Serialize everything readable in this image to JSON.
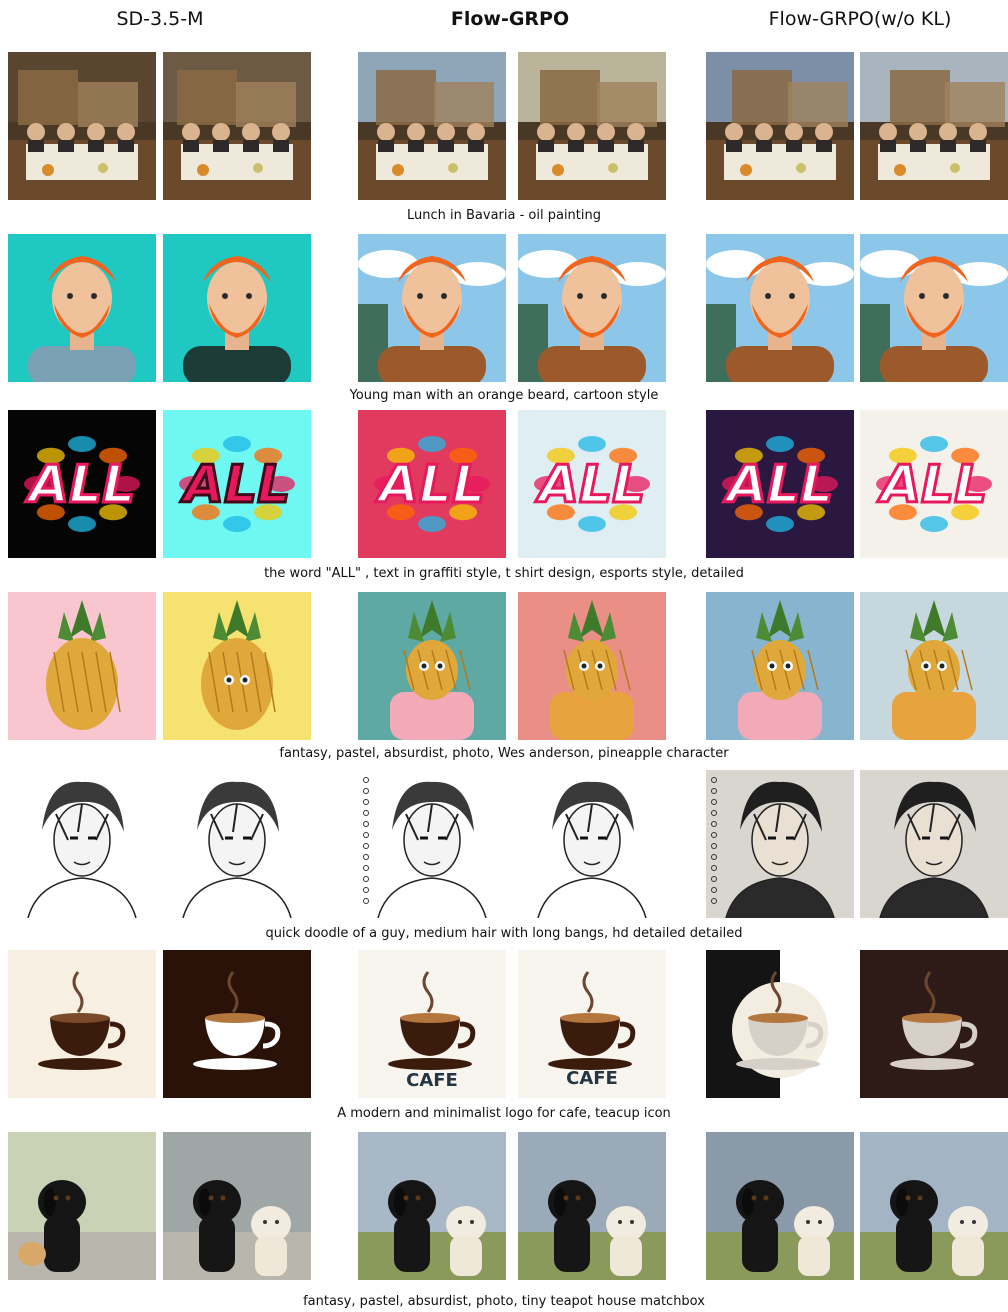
{
  "columns": [
    "SD-3.5-M",
    "Flow-GRPO",
    "Flow-GRPO(w/o KL)"
  ],
  "rows": [
    {
      "caption": "Lunch in Bavaria - oil painting",
      "theme": "painting"
    },
    {
      "caption": "Young man with an orange beard, cartoon style",
      "theme": "beard"
    },
    {
      "caption": "the word \"ALL\" , text in graffiti style, t shirt design, esports style, detailed",
      "theme": "graffiti"
    },
    {
      "caption": "fantasy, pastel, absurdist, photo, Wes anderson, pineapple character",
      "theme": "pineapple"
    },
    {
      "caption": "quick doodle of a guy, medium hair with long bangs, hd detailed detailed",
      "theme": "sketch"
    },
    {
      "caption": "A modern and minimalist logo for cafe, teacup icon",
      "theme": "cafe"
    },
    {
      "caption": "fantasy, pastel, absurdist, photo, tiny teapot house matchbox",
      "theme": "dogs"
    }
  ],
  "image_text": {
    "graffiti_word": "ALL",
    "cafe_word": "CAFE"
  },
  "colors": {
    "beard_orange": "#f0641e",
    "teal_bg": "#1fc9c2",
    "graffiti_pink": "#e8185c",
    "coffee_brown": "#3b1c0c",
    "cream": "#f7efe1"
  }
}
